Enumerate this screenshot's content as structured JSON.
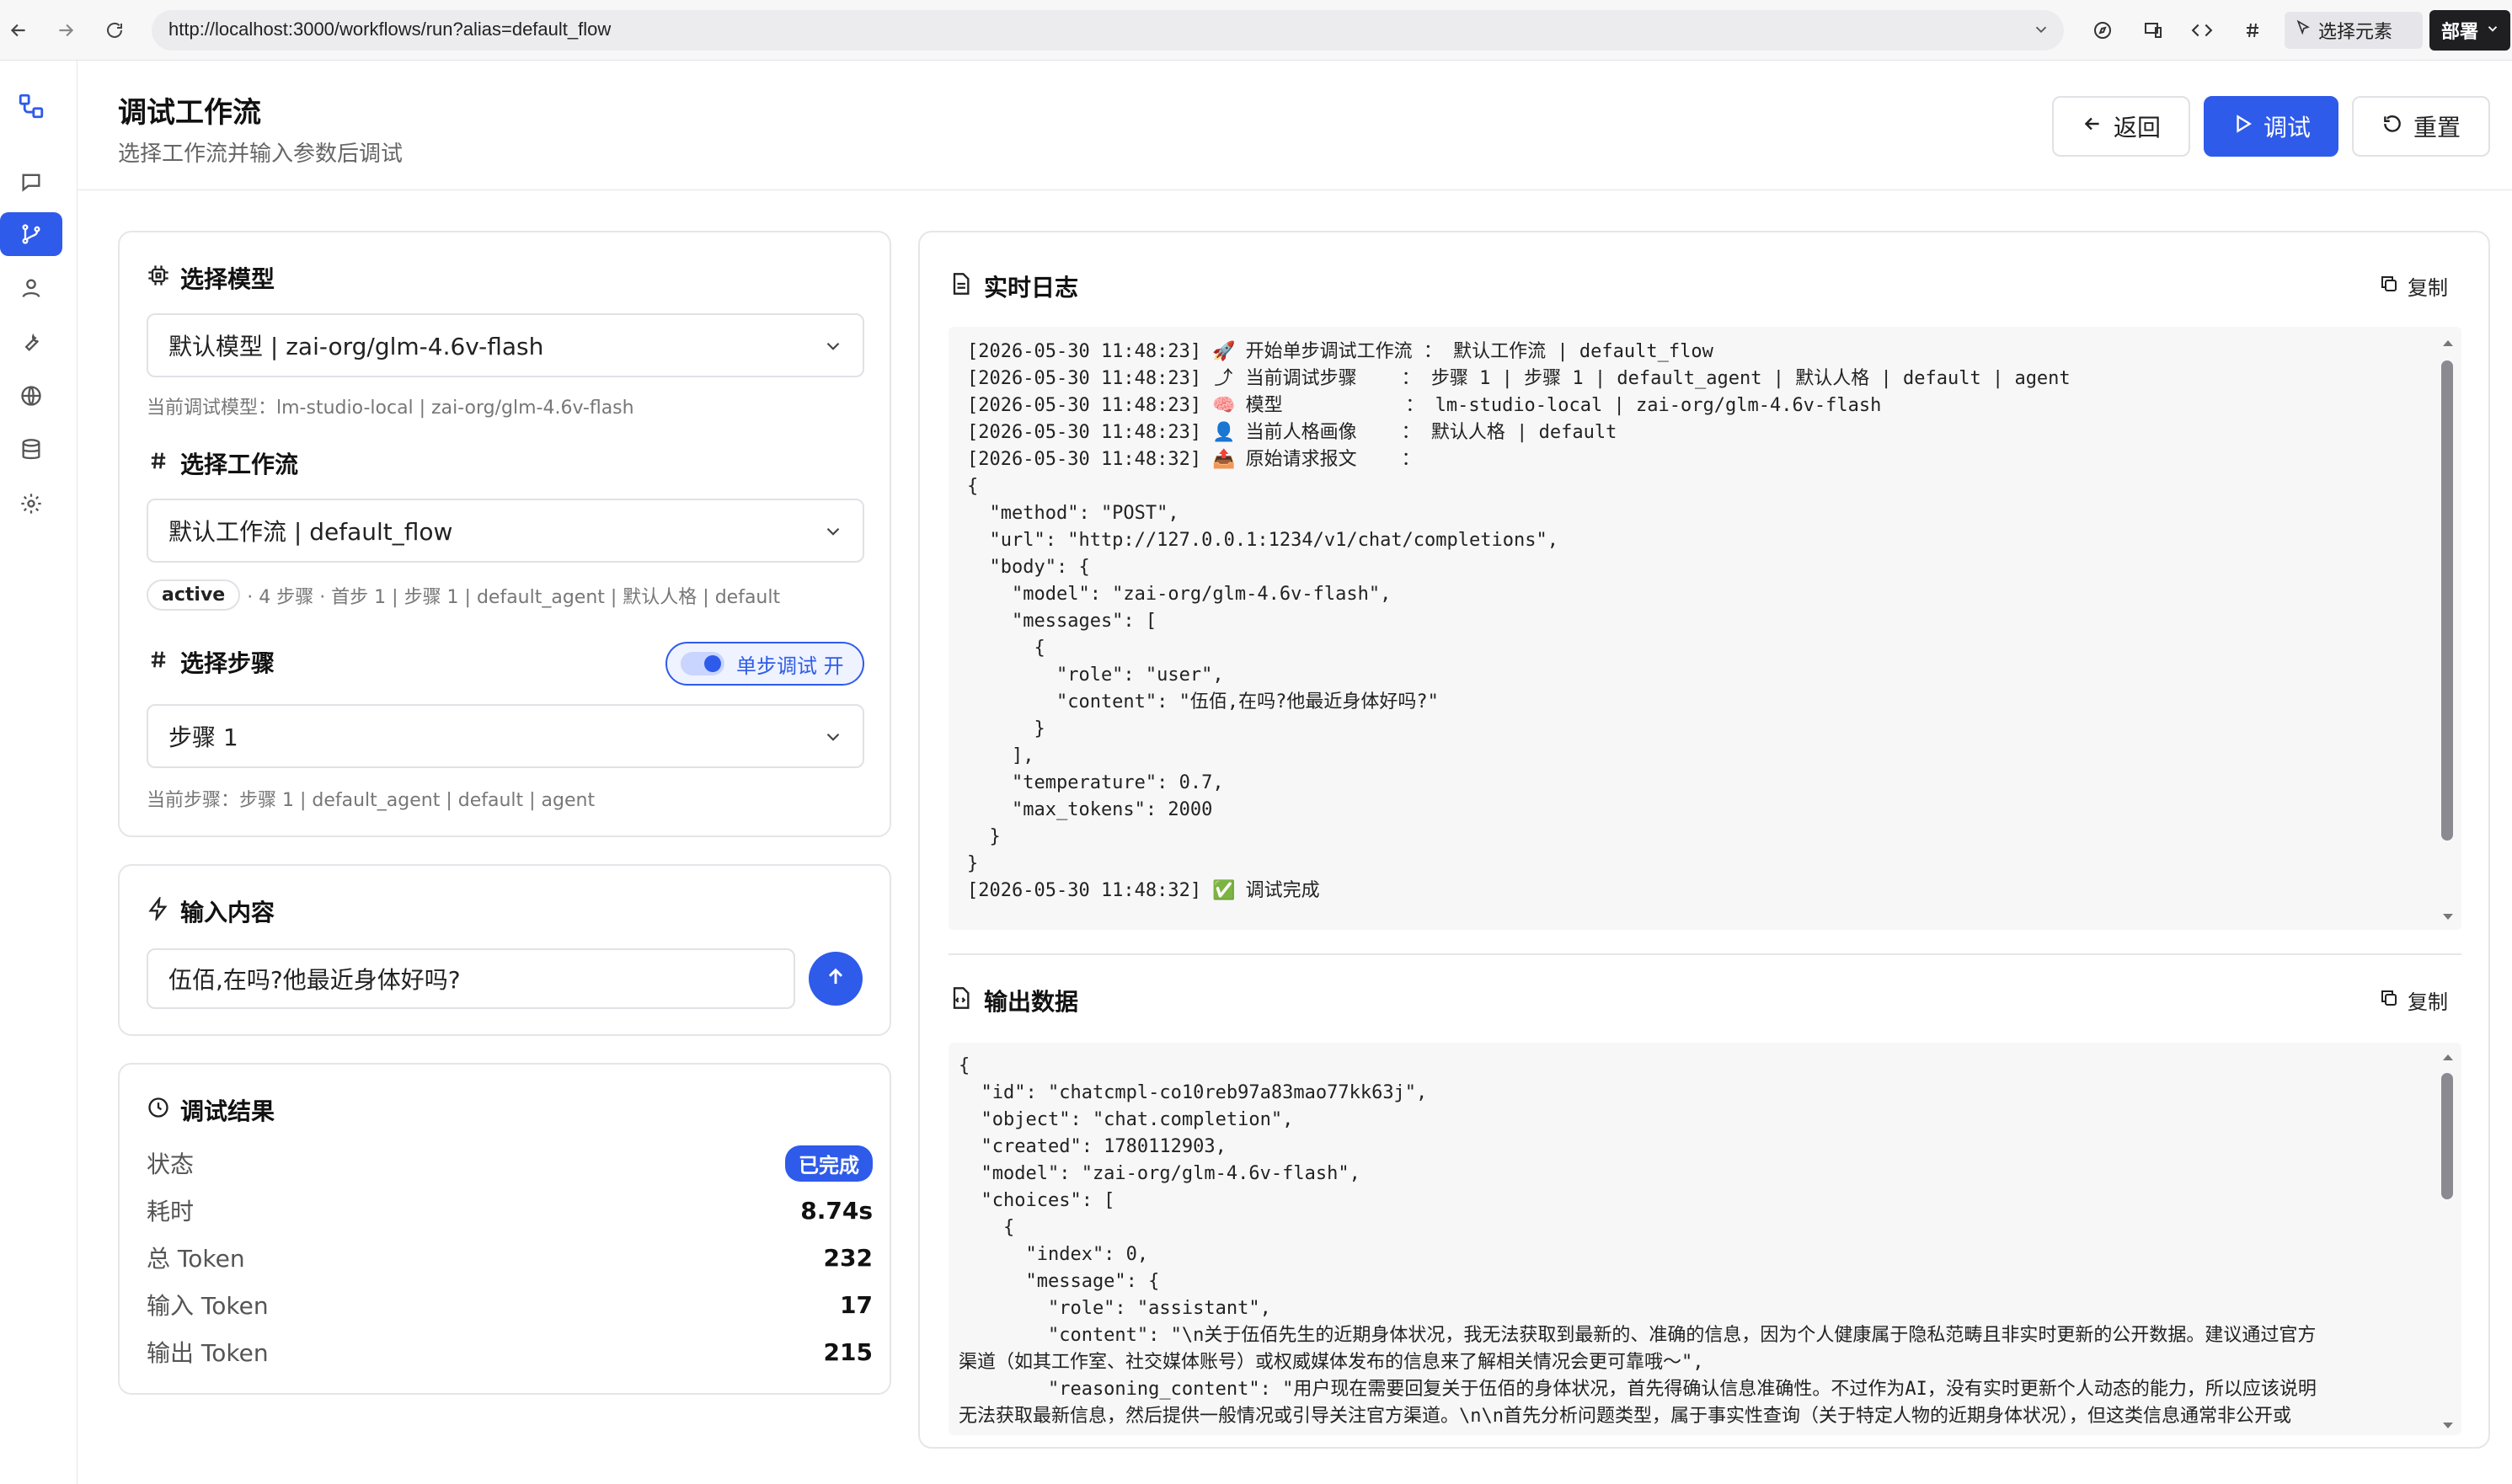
{
  "browser": {
    "url": "http://localhost:3000/workflows/run?alias=default_flow",
    "select_element_label": "选择元素",
    "deploy_label": "部署"
  },
  "header": {
    "title": "调试工作流",
    "subtitle": "选择工作流并输入参数后调试",
    "back_label": "返回",
    "debug_label": "调试",
    "reset_label": "重置"
  },
  "model_section": {
    "title": "选择模型",
    "selected": "默认模型 | zai-org/glm-4.6v-flash",
    "hint": "当前调试模型：lm-studio-local | zai-org/glm-4.6v-flash"
  },
  "workflow_section": {
    "title": "选择工作流",
    "selected": "默认工作流 | default_flow",
    "status_badge": "active",
    "meta": "· 4 步骤 · 首步 1 | 步骤 1 | default_agent | 默认人格 | default"
  },
  "step_section": {
    "title": "选择步骤",
    "toggle_label": "单步调试 开",
    "selected": "步骤 1",
    "hint": "当前步骤：步骤 1 | default_agent | default | agent"
  },
  "input_section": {
    "title": "输入内容",
    "value": "伍佰,在吗?他最近身体好吗?"
  },
  "result_section": {
    "title": "调试结果",
    "rows": [
      {
        "key": "状态",
        "value": "已完成"
      },
      {
        "key": "耗时",
        "value": "8.74s"
      },
      {
        "key": "总 Token",
        "value": "232"
      },
      {
        "key": "输入 Token",
        "value": "17"
      },
      {
        "key": "输出 Token",
        "value": "215"
      }
    ]
  },
  "log_panel": {
    "title": "实时日志",
    "copy_label": "复制",
    "lines": [
      {
        "ts": "[2026-05-30 11:48:23]",
        "icon": "🚀",
        "text": "开始单步调试工作流 ： 默认工作流 | default_flow"
      },
      {
        "ts": "[2026-05-30 11:48:23]",
        "icon": "⤴",
        "text": "当前调试步骤    ： 步骤 1 | 步骤 1 | default_agent | 默认人格 | default | agent"
      },
      {
        "ts": "[2026-05-30 11:48:23]",
        "icon": "🧠",
        "text": "模型           ： lm-studio-local | zai-org/glm-4.6v-flash"
      },
      {
        "ts": "[2026-05-30 11:48:23]",
        "icon": "👤",
        "text": "当前人格画像    ： 默认人格 | default"
      },
      {
        "ts": "[2026-05-30 11:48:32]",
        "icon": "📤",
        "text": "原始请求报文    ："
      }
    ],
    "json_lines": [
      "{",
      "  \"method\": \"POST\",",
      "  \"url\": \"http://127.0.0.1:1234/v1/chat/completions\",",
      "  \"body\": {",
      "    \"model\": \"zai-org/glm-4.6v-flash\",",
      "    \"messages\": [",
      "      {",
      "        \"role\": \"user\",",
      "        \"content\": \"伍佰,在吗?他最近身体好吗?\"",
      "      }",
      "    ],",
      "    \"temperature\": 0.7,",
      "    \"max_tokens\": 2000",
      "  }",
      "}"
    ],
    "final_line": {
      "ts": "[2026-05-30 11:48:32]",
      "icon": "✅",
      "text": "调试完成"
    }
  },
  "output_panel": {
    "title": "输出数据",
    "copy_label": "复制",
    "lines": [
      "{",
      "  \"id\": \"chatcmpl-co10reb97a83mao77kk63j\",",
      "  \"object\": \"chat.completion\",",
      "  \"created\": 1780112903,",
      "  \"model\": \"zai-org/glm-4.6v-flash\",",
      "  \"choices\": [",
      "    {",
      "      \"index\": 0,",
      "      \"message\": {",
      "        \"role\": \"assistant\",",
      "        \"content\": \"\\n关于伍佰先生的近期身体状况，我无法获取到最新的、准确的信息，因为个人健康属于隐私范畴且非实时更新的公开数据。建议通过官方",
      "渠道（如其工作室、社交媒体账号）或权威媒体发布的信息来了解相关情况会更可靠哦～\",",
      "        \"reasoning_content\": \"用户现在需要回复关于伍佰的身体状况，首先得确认信息准确性。不过作为AI，没有实时更新个人动态的能力，所以应该说明",
      "无法获取最新信息，然后提供一般情况或引导关注官方渠道。\\n\\n首先分析问题类型，属于事实性查询（关于特定人物的近期身体状况），但这类信息通常非公开或"
    ]
  }
}
